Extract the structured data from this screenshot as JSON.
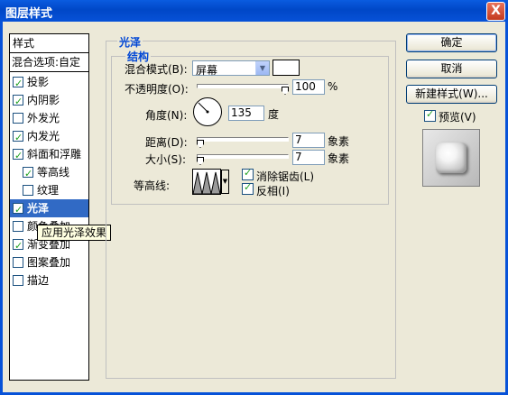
{
  "window": {
    "title": "图层样式",
    "close_glyph": "X"
  },
  "style_list": {
    "header": "样式",
    "blend_options": "混合选项:自定",
    "items": [
      {
        "label": "投影",
        "checked": true,
        "indent": false,
        "selected": false
      },
      {
        "label": "内阴影",
        "checked": true,
        "indent": false,
        "selected": false
      },
      {
        "label": "外发光",
        "checked": false,
        "indent": false,
        "selected": false
      },
      {
        "label": "内发光",
        "checked": true,
        "indent": false,
        "selected": false
      },
      {
        "label": "斜面和浮雕",
        "checked": true,
        "indent": false,
        "selected": false
      },
      {
        "label": "等高线",
        "checked": true,
        "indent": true,
        "selected": false
      },
      {
        "label": "纹理",
        "checked": false,
        "indent": true,
        "selected": false
      },
      {
        "label": "光泽",
        "checked": true,
        "indent": false,
        "selected": true
      },
      {
        "label": "颜色叠加",
        "checked": false,
        "indent": false,
        "selected": false
      },
      {
        "label": "渐变叠加",
        "checked": true,
        "indent": false,
        "selected": false
      },
      {
        "label": "图案叠加",
        "checked": false,
        "indent": false,
        "selected": false
      },
      {
        "label": "描边",
        "checked": false,
        "indent": false,
        "selected": false
      }
    ],
    "tooltip": "应用光泽效果"
  },
  "satin": {
    "section_title": "光泽",
    "structure_title": "结构",
    "blend_mode": {
      "label": "混合模式(B):",
      "value": "屏幕",
      "color": "#ffffff"
    },
    "opacity": {
      "label": "不透明度(O):",
      "value": "100",
      "unit": "%",
      "fraction": 1.0
    },
    "angle": {
      "label": "角度(N):",
      "value": "135",
      "unit": "度"
    },
    "distance": {
      "label": "距离(D):",
      "value": "7",
      "unit": "象素",
      "fraction": 0.0
    },
    "size": {
      "label": "大小(S):",
      "value": "7",
      "unit": "象素",
      "fraction": 0.0
    },
    "contour": {
      "label": "等高线:"
    },
    "antialias": {
      "label": "消除锯齿(L)",
      "checked": true
    },
    "invert": {
      "label": "反相(I)",
      "checked": true
    }
  },
  "buttons": {
    "ok": "确定",
    "cancel": "取消",
    "new_style": "新建样式(W)...",
    "preview_label": "预览(V)",
    "preview_checked": true
  }
}
